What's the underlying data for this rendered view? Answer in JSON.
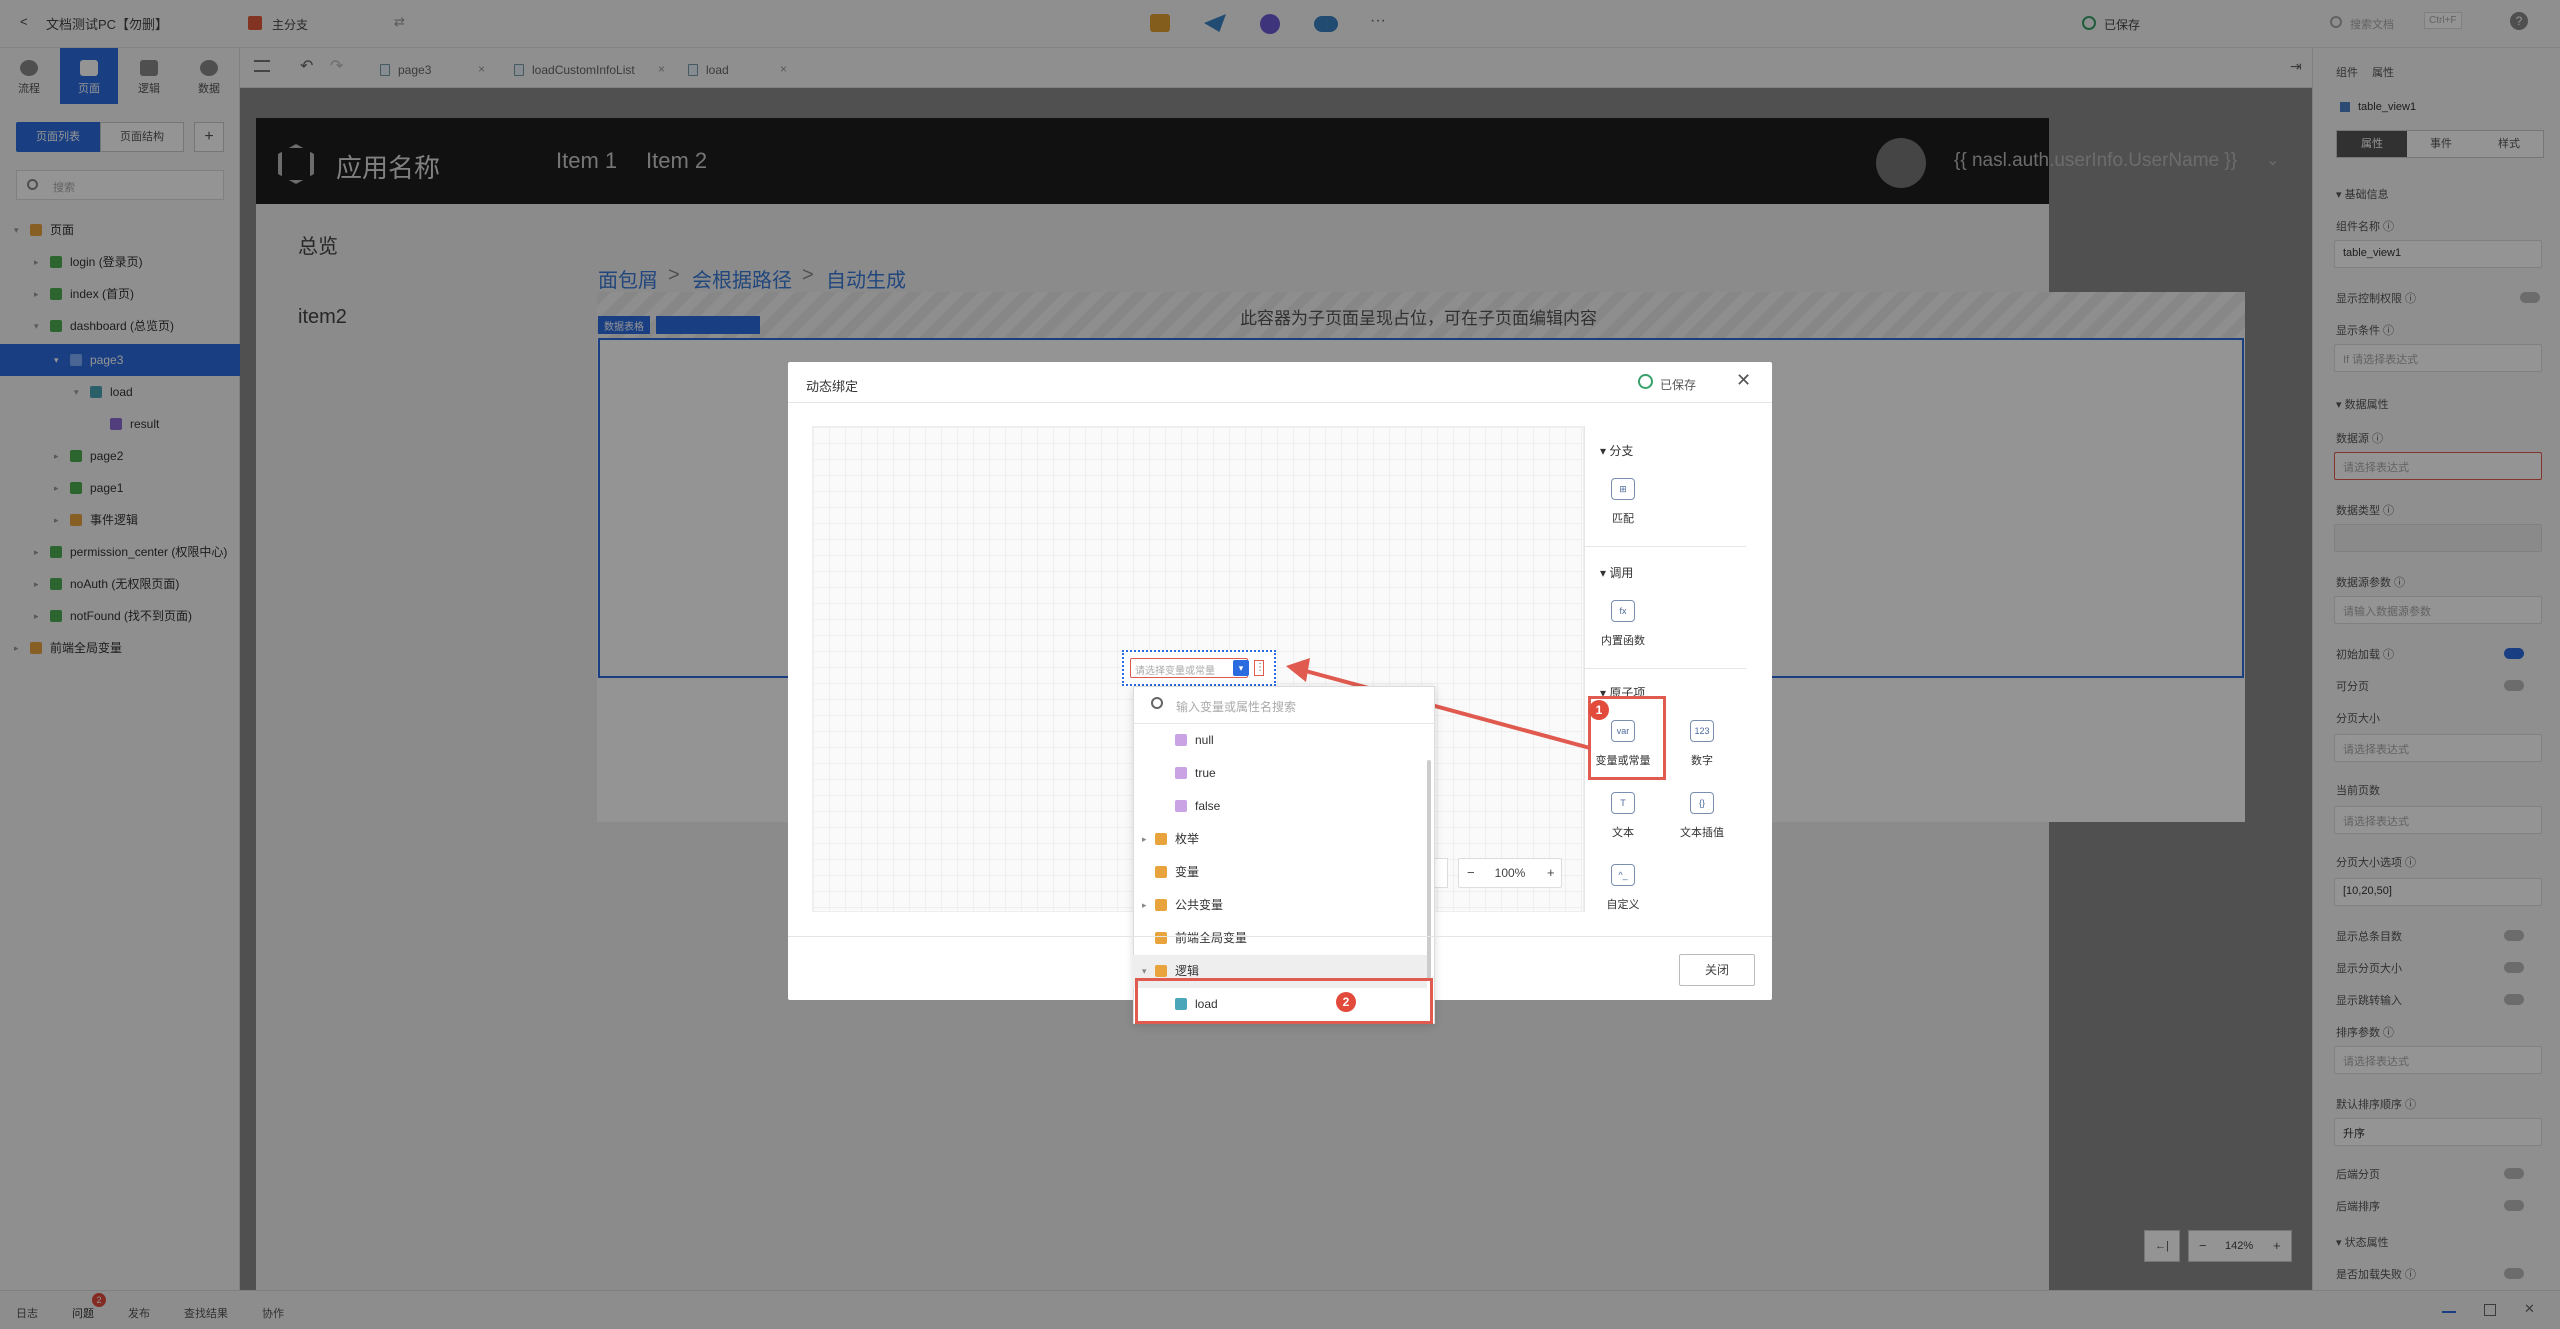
{
  "topbar": {
    "back_arrow": "<",
    "project_name": "文档测试PC【勿删】",
    "branch_label": "主分支",
    "branch_swap": "⇄",
    "more": "···",
    "saved_status": "已保存",
    "search_placeholder": "搜索文档",
    "search_shortcut": "Ctrl+F",
    "help": "?"
  },
  "modes": [
    {
      "label": "流程"
    },
    {
      "label": "页面"
    },
    {
      "label": "逻辑"
    },
    {
      "label": "数据"
    }
  ],
  "editor_tabs": [
    {
      "label": "page3"
    },
    {
      "label": "loadCustomInfoList"
    },
    {
      "label": "load"
    }
  ],
  "left_panel": {
    "tab_page_list": "页面列表",
    "tab_page_structure": "页面结构",
    "add_button": "+",
    "search_placeholder": "搜索",
    "tree": [
      {
        "label": "页面",
        "arrow": "▾"
      },
      {
        "label": "login (登录页)",
        "arrow": "▸"
      },
      {
        "label": "index (首页)",
        "arrow": "▸"
      },
      {
        "label": "dashboard (总览页)",
        "arrow": "▾"
      },
      {
        "label": "page3",
        "arrow": "▾"
      },
      {
        "label": "load",
        "arrow": "▾"
      },
      {
        "label": "result",
        "arrow": ""
      },
      {
        "label": "page2",
        "arrow": "▸"
      },
      {
        "label": "page1",
        "arrow": "▸"
      },
      {
        "label": "事件逻辑",
        "arrow": "▸"
      },
      {
        "label": "permission_center (权限中心)",
        "arrow": "▸"
      },
      {
        "label": "noAuth (无权限页面)",
        "arrow": "▸"
      },
      {
        "label": "notFound (找不到页面)",
        "arrow": "▸"
      },
      {
        "label": "前端全局变量",
        "arrow": "▸"
      }
    ]
  },
  "preview": {
    "app_name": "应用名称",
    "nav_items": [
      "Item 1",
      "Item 2"
    ],
    "user_expr": "{{ nasl.auth.userInfo.UserName }}",
    "side_items": [
      "总览",
      "item2"
    ],
    "breadcrumb": [
      "面包屑",
      ">",
      "会根据路径",
      ">",
      "自动生成"
    ],
    "placeholder_text": "此容器为子页面呈现占位，可在子页面编辑内容",
    "component_tag": "数据表格"
  },
  "modal": {
    "title": "动态绑定",
    "saved": "已保存",
    "close_icon": "✕",
    "palette_sections": [
      {
        "title": "分支",
        "items": [
          {
            "icon": "⊞",
            "label": "匹配"
          }
        ]
      },
      {
        "title": "调用",
        "items": [
          {
            "icon": "fx",
            "label": "内置函数"
          }
        ]
      },
      {
        "title": "原子项",
        "items": [
          {
            "icon": "var",
            "label": "变量或常量"
          },
          {
            "icon": "123",
            "label": "数字"
          },
          {
            "icon": "T",
            "label": "文本"
          },
          {
            "icon": "{}",
            "label": "文本插值"
          },
          {
            "icon": "^_",
            "label": "自定义"
          }
        ]
      }
    ],
    "expr_placeholder": "请选择变量或常量",
    "dropdown": {
      "search_placeholder": "输入变量或属性名搜索",
      "items": [
        {
          "label": "null",
          "type": "value"
        },
        {
          "label": "true",
          "type": "value"
        },
        {
          "label": "false",
          "type": "value"
        },
        {
          "label": "枚举",
          "type": "folder"
        },
        {
          "label": "变量",
          "type": "folder"
        },
        {
          "label": "公共变量",
          "type": "folder"
        },
        {
          "label": "前端全局变量",
          "type": "folder"
        },
        {
          "label": "逻辑",
          "type": "folder"
        },
        {
          "label": "load",
          "type": "logic"
        }
      ]
    },
    "zoom_level": "100%",
    "zoom_minus": "−",
    "zoom_plus": "+",
    "close_button": "关闭",
    "badge_1": "1",
    "badge_2": "2"
  },
  "right_panel": {
    "header_component": "组件",
    "header_property": "属性",
    "component_name_label": "table_view1",
    "tabs": [
      "属性",
      "事件",
      "样式"
    ],
    "sections": {
      "basic": "基础信息",
      "data": "数据属性",
      "state": "状态属性"
    },
    "fields": [
      {
        "label": "组件名称 ⓘ",
        "value": "table_view1"
      },
      {
        "label": "显示控制权限 ⓘ"
      },
      {
        "label": "显示条件 ⓘ",
        "value": "If   请选择表达式"
      },
      {
        "label": "数据源 ⓘ",
        "value": "请选择表达式"
      },
      {
        "label": "数据类型 ⓘ",
        "value": ""
      },
      {
        "label": "数据源参数 ⓘ",
        "value": "请输入数据源参数"
      },
      {
        "label": "初始加载 ⓘ"
      },
      {
        "label": "可分页"
      },
      {
        "label": "分页大小",
        "value": "请选择表达式"
      },
      {
        "label": "当前页数",
        "value": "请选择表达式"
      },
      {
        "label": "分页大小选项 ⓘ",
        "value": "[10,20,50]"
      },
      {
        "label": "显示总条目数"
      },
      {
        "label": "显示分页大小"
      },
      {
        "label": "显示跳转输入"
      },
      {
        "label": "排序参数 ⓘ",
        "value": "请选择表达式"
      },
      {
        "label": "默认排序顺序 ⓘ",
        "value": "升序"
      },
      {
        "label": "后端分页"
      },
      {
        "label": "后端排序"
      },
      {
        "label": "是否加载失败 ⓘ"
      }
    ]
  },
  "canvas_zoom": {
    "left": "←|",
    "minus": "−",
    "value": "142%",
    "plus": "+"
  },
  "bottombar": {
    "items": [
      "日志",
      "问题",
      "发布",
      "查找结果",
      "协作"
    ],
    "problem_badge": "2"
  },
  "colors": {
    "accent": "#2b6be0",
    "highlight": "#e05a4f",
    "saved": "#38a169"
  }
}
